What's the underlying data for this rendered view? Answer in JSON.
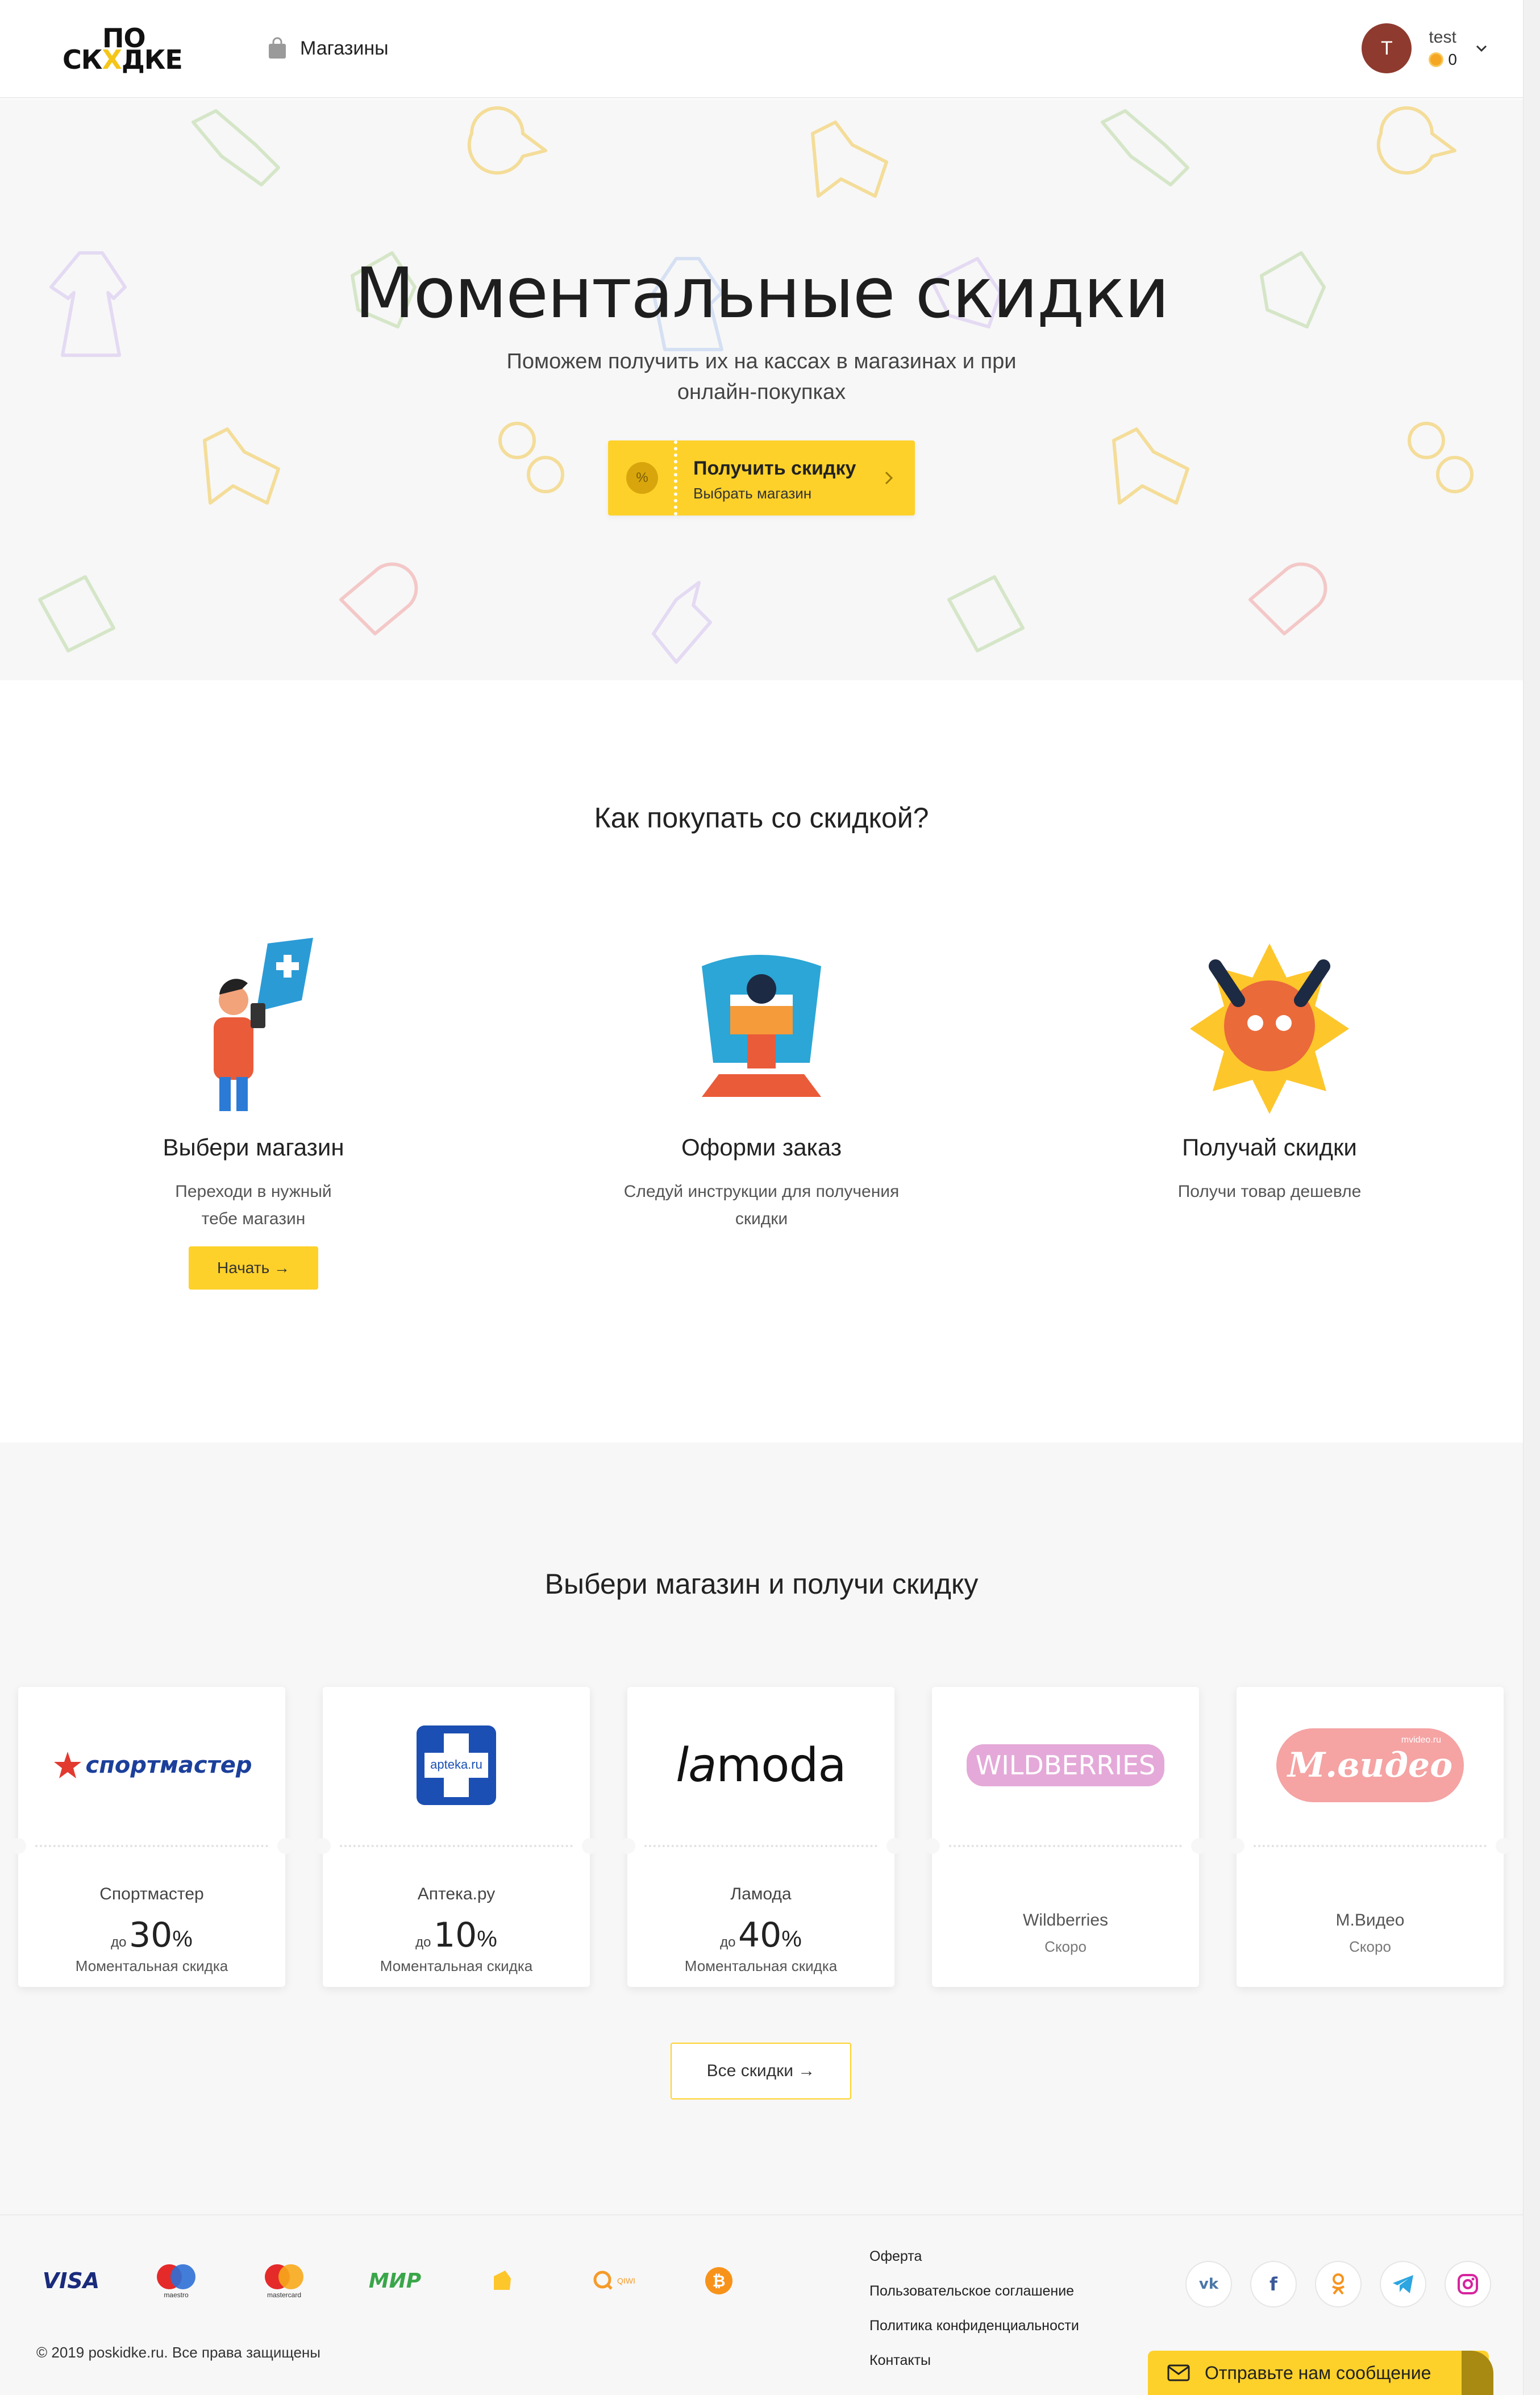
{
  "header": {
    "logo_top": "ПО",
    "logo_bottom_a": "СК",
    "logo_bottom_x": "Х",
    "logo_bottom_b": "ДКЕ",
    "nav_shops": "Магазины",
    "user_initial": "T",
    "user_name": "test",
    "user_coins": "0"
  },
  "hero": {
    "title": "Моментальные скидки",
    "subtitle": "Поможем получить их на кассах в магазинах и при онлайн-покупках",
    "button_title": "Получить скидку",
    "button_sub": "Выбрать магазин",
    "button_badge": "%"
  },
  "howto": {
    "title": "Как покупать со скидкой?",
    "steps": [
      {
        "title": "Выбери магазин",
        "desc": "Переходи в нужный тебе магазин",
        "button": "Начать →"
      },
      {
        "title": "Оформи заказ",
        "desc": "Следуй инструкции для получения скидки"
      },
      {
        "title": "Получай скидки",
        "desc": "Получи товар дешевле"
      }
    ]
  },
  "shops": {
    "title": "Выбери магазин и получи скидку",
    "cards": [
      {
        "name": "Спортмастер",
        "pre": "до",
        "value": "30",
        "unit": "%",
        "label": "Моментальная скидка",
        "logo_text": "спортмастер"
      },
      {
        "name": "Аптека.ру",
        "pre": "до",
        "value": "10",
        "unit": "%",
        "label": "Моментальная скидка",
        "logo_text": "apteka.ru"
      },
      {
        "name": "Ламода",
        "pre": "до",
        "value": "40",
        "unit": "%",
        "label": "Моментальная скидка",
        "logo_text_a": "la",
        "logo_text_b": "moda"
      },
      {
        "name": "Wildberries",
        "soon": "Скоро",
        "logo_text": "WILDBERRIES"
      },
      {
        "name": "М.Видео",
        "soon": "Скоро",
        "logo_text": "М.видео",
        "logo_small": "mvideo.ru"
      }
    ],
    "all_button": "Все скидки →"
  },
  "footer": {
    "payments": [
      "VISA",
      "maestro",
      "mastercard",
      "МИР",
      "Яндекс",
      "QIWI",
      "bitcoin"
    ],
    "copyright": "© 2019 poskidke.ru. Все права защищены",
    "links": [
      "Оферта",
      "Пользовательское соглашение",
      "Политика конфиденциальности",
      "Контакты"
    ],
    "socials": [
      "vk-icon",
      "facebook-icon",
      "odnoklassniki-icon",
      "telegram-icon",
      "instagram-icon"
    ],
    "chat_button": "Отправьте нам сообщение"
  },
  "colors": {
    "accent": "#fdd12a",
    "avatar": "#8e3a2f",
    "hero_bg": "#f7f7f7"
  }
}
